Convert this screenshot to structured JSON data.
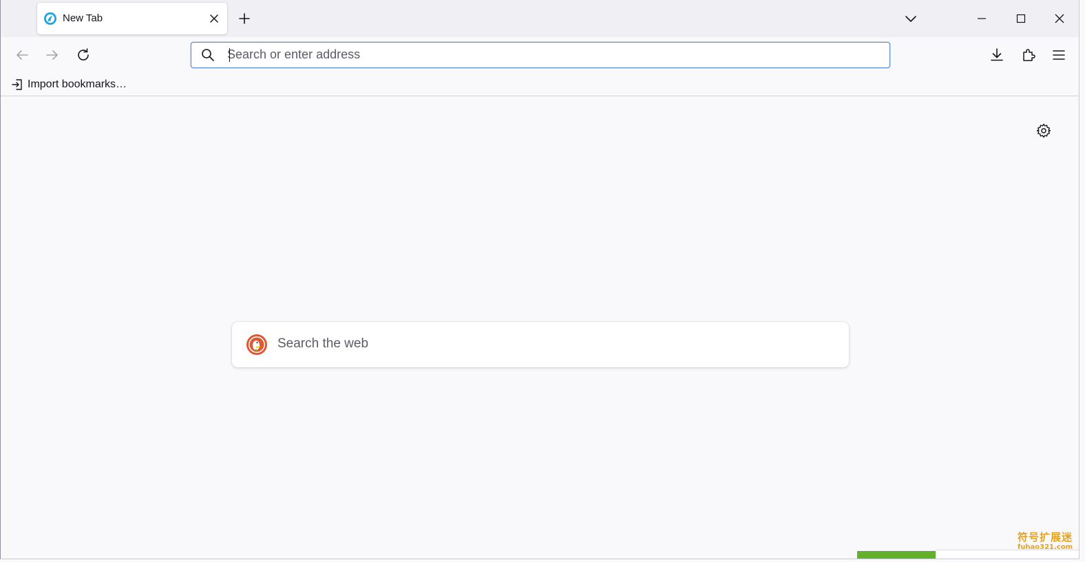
{
  "tabstrip": {
    "tabs": [
      {
        "title": "New Tab",
        "favicon": "firefox-logo-icon",
        "active": true
      }
    ],
    "new_tab_icon": "plus-icon",
    "list_all_tabs_icon": "chevron-down-icon"
  },
  "window_controls": {
    "minimize_icon": "minimize-icon",
    "maximize_icon": "maximize-icon",
    "close_icon": "close-icon"
  },
  "navbar": {
    "back_icon": "arrow-left-icon",
    "forward_icon": "arrow-right-icon",
    "reload_icon": "reload-icon",
    "urlbar": {
      "placeholder": "Search or enter address",
      "value": "",
      "focused": true
    },
    "downloads_icon": "download-icon",
    "extensions_icon": "puzzle-piece-icon",
    "menu_icon": "hamburger-menu-icon"
  },
  "bookmarks_bar": {
    "items": [
      {
        "label": "Import bookmarks…",
        "icon": "import-icon"
      }
    ]
  },
  "content": {
    "settings_icon": "gear-icon",
    "search": {
      "engine_icon": "duckduckgo-icon",
      "placeholder": "Search the web"
    }
  },
  "watermark": {
    "chinese_text": "符号扩展迷",
    "url_text": "fuhao321.com"
  },
  "colors": {
    "accent": "#5b8ad6",
    "tabstrip_bg": "#f0f0f4",
    "page_bg": "#f9f9fb",
    "green_bar": "#63b02a",
    "watermark": "#e6a21a"
  }
}
